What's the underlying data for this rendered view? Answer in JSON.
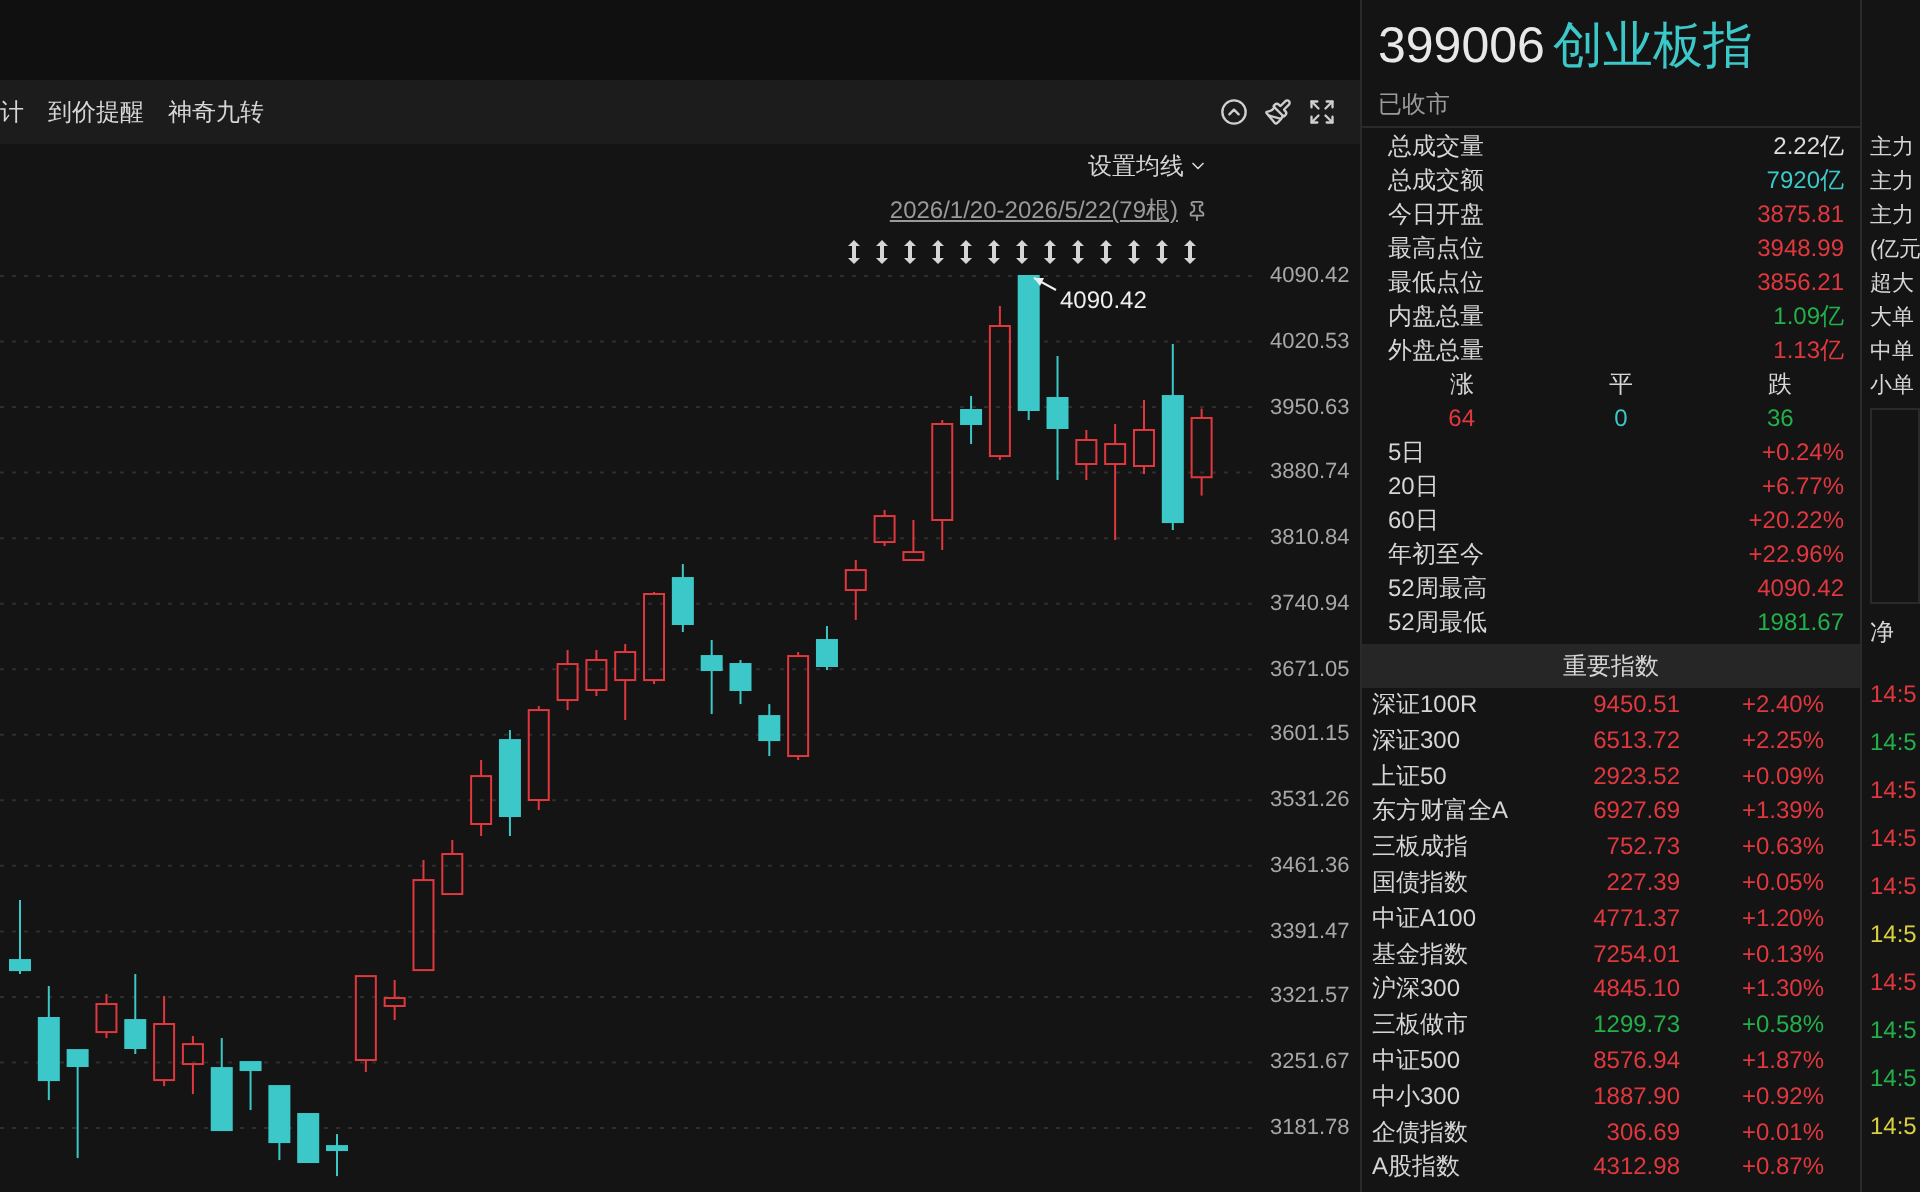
{
  "toolbar": {
    "tabs": [
      {
        "label": "计",
        "selected": false
      },
      {
        "label": "到价提醒",
        "selected": false
      },
      {
        "label": "神奇九转",
        "selected": false
      }
    ]
  },
  "chart": {
    "ma_setting": "设置均线",
    "range": "2026/1/20-2026/5/22(79根)",
    "peak_label": "4090.42",
    "chart_data": {
      "type": "candlestick",
      "grid": true,
      "ylim": [
        3181.78,
        4090.42
      ],
      "ohlc": [
        [
          3360.9,
          3424.9,
          3346.0,
          3350.2
        ],
        [
          3299.1,
          3333.2,
          3211.6,
          3232.9
        ],
        [
          3264.9,
          3264.9,
          3149.7,
          3247.9
        ],
        [
          3284.1,
          3324.7,
          3277.7,
          3314.0
        ],
        [
          3296.9,
          3346.0,
          3260.7,
          3267.1
        ],
        [
          3232.9,
          3322.5,
          3226.5,
          3292.7
        ],
        [
          3250.0,
          3279.9,
          3218.0,
          3271.3
        ],
        [
          3245.7,
          3277.7,
          3179.6,
          3179.6
        ],
        [
          3252.1,
          3252.1,
          3200.9,
          3243.6
        ],
        [
          3226.5,
          3226.5,
          3147.6,
          3166.8
        ],
        [
          3196.7,
          3196.7,
          3145.5,
          3145.5
        ],
        [
          3162.5,
          3175.3,
          3130.5,
          3158.3
        ],
        [
          3254.3,
          3343.8,
          3241.5,
          3343.8
        ],
        [
          3311.9,
          3339.6,
          3296.9,
          3320.4
        ],
        [
          3350.2,
          3467.6,
          3350.2,
          3446.2
        ],
        [
          3431.3,
          3488.9,
          3431.3,
          3474.0
        ],
        [
          3506.0,
          3574.2,
          3493.2,
          3557.1
        ],
        [
          3595.5,
          3606.2,
          3493.2,
          3514.5
        ],
        [
          3531.6,
          3631.8,
          3520.9,
          3627.5
        ],
        [
          3638.2,
          3691.5,
          3627.5,
          3676.6
        ],
        [
          3648.9,
          3691.5,
          3642.5,
          3680.9
        ],
        [
          3659.5,
          3697.9,
          3616.9,
          3689.4
        ],
        [
          3659.5,
          3753.4,
          3655.3,
          3751.3
        ],
        [
          3768.3,
          3783.2,
          3710.7,
          3719.3
        ],
        [
          3685.1,
          3702.2,
          3623.3,
          3670.2
        ],
        [
          3676.6,
          3680.9,
          3633.9,
          3648.9
        ],
        [
          3621.1,
          3633.9,
          3578.5,
          3595.5
        ],
        [
          3578.5,
          3689.4,
          3574.2,
          3685.1
        ],
        [
          3702.2,
          3717.1,
          3670.2,
          3674.5
        ],
        [
          3755.5,
          3787.5,
          3723.5,
          3776.8
        ],
        [
          3806.7,
          3840.8,
          3802.4,
          3834.4
        ],
        [
          3787.5,
          3830.2,
          3787.5,
          3796.0
        ],
        [
          3830.2,
          3936.8,
          3798.2,
          3932.6
        ],
        [
          3947.5,
          3962.4,
          3911.2,
          3932.6
        ],
        [
          3898.4,
          4058.4,
          3894.2,
          4037.1
        ],
        [
          4090.42,
          4090.42,
          3936.8,
          3947.5
        ],
        [
          3960.3,
          4005.1,
          3872.8,
          3928.3
        ],
        [
          3889.9,
          3926.2,
          3872.8,
          3915.5
        ],
        [
          3889.9,
          3932.6,
          3808.8,
          3911.2
        ],
        [
          3887.8,
          3958.2,
          3879.2,
          3926.2
        ],
        [
          3962.4,
          4017.9,
          3819.5,
          3828.0
        ],
        [
          3875.81,
          3948.99,
          3856.21,
          3939.0
        ]
      ],
      "yticks": [
        4090.42,
        4020.53,
        3950.63,
        3880.74,
        3810.84,
        3740.94,
        3671.05,
        3601.15,
        3531.26,
        3461.36,
        3391.47,
        3321.57,
        3251.67,
        3181.78
      ]
    }
  },
  "quote": {
    "code": "399006",
    "name": "创业板指",
    "status": "已收市",
    "stats": [
      {
        "label": "总成交量",
        "value": "2.22亿",
        "color": "#dddddd"
      },
      {
        "label": "总成交额",
        "value": "7920亿",
        "color": "#3cc8c8"
      },
      {
        "label": "今日开盘",
        "value": "3875.81",
        "color": "#e0383e"
      },
      {
        "label": "最高点位",
        "value": "3948.99",
        "color": "#e0383e"
      },
      {
        "label": "最低点位",
        "value": "3856.21",
        "color": "#e0383e"
      },
      {
        "label": "内盘总量",
        "value": "1.09亿",
        "color": "#22b04a"
      },
      {
        "label": "外盘总量",
        "value": "1.13亿",
        "color": "#e0383e"
      }
    ],
    "breadth": [
      {
        "label": "涨",
        "value": "64",
        "color": "#e0383e"
      },
      {
        "label": "平",
        "value": "0",
        "color": "#3cc8c8"
      },
      {
        "label": "跌",
        "value": "36",
        "color": "#22b04a"
      }
    ],
    "periods": [
      {
        "label": "5日",
        "value": "+0.24%",
        "color": "#e0383e"
      },
      {
        "label": "20日",
        "value": "+6.77%",
        "color": "#e0383e"
      },
      {
        "label": "60日",
        "value": "+20.22%",
        "color": "#e0383e"
      },
      {
        "label": "年初至今",
        "value": "+22.96%",
        "color": "#e0383e"
      },
      {
        "label": "52周最高",
        "value": "4090.42",
        "color": "#e0383e"
      },
      {
        "label": "52周最低",
        "value": "1981.67",
        "color": "#22b04a"
      }
    ]
  },
  "indices": {
    "title": "重要指数",
    "rows": [
      {
        "name": "深证100R",
        "value": "9450.51",
        "change": "+2.40%",
        "color": "#e0383e"
      },
      {
        "name": "深证300",
        "value": "6513.72",
        "change": "+2.25%",
        "color": "#e0383e"
      },
      {
        "name": "上证50",
        "value": "2923.52",
        "change": "+0.09%",
        "color": "#e0383e"
      },
      {
        "name": "东方财富全A",
        "value": "6927.69",
        "change": "+1.39%",
        "color": "#e0383e"
      },
      {
        "name": "三板成指",
        "value": "752.73",
        "change": "+0.63%",
        "color": "#e0383e"
      },
      {
        "name": "国债指数",
        "value": "227.39",
        "change": "+0.05%",
        "color": "#e0383e"
      },
      {
        "name": "中证A100",
        "value": "4771.37",
        "change": "+1.20%",
        "color": "#e0383e"
      },
      {
        "name": "基金指数",
        "value": "7254.01",
        "change": "+0.13%",
        "color": "#e0383e"
      },
      {
        "name": "沪深300",
        "value": "4845.10",
        "change": "+1.30%",
        "color": "#e0383e"
      },
      {
        "name": "三板做市",
        "value": "1299.73",
        "change": "+0.58%",
        "color": "#22b04a"
      },
      {
        "name": "中证500",
        "value": "8576.94",
        "change": "+1.87%",
        "color": "#e0383e"
      },
      {
        "name": "中小300",
        "value": "1887.90",
        "change": "+0.92%",
        "color": "#e0383e"
      },
      {
        "name": "企债指数",
        "value": "306.69",
        "change": "+0.01%",
        "color": "#e0383e"
      },
      {
        "name": "A股指数",
        "value": "4312.98",
        "change": "+0.87%",
        "color": "#e0383e"
      }
    ]
  },
  "flow": {
    "labels": [
      "主力",
      "主力",
      "主力",
      "(亿元",
      "超大",
      "大单",
      "中单",
      "小单"
    ],
    "net": "净",
    "times": [
      {
        "text": "14:5",
        "color": "#e0383e"
      },
      {
        "text": "14:5",
        "color": "#22b04a"
      },
      {
        "text": "14:5",
        "color": "#e0383e"
      },
      {
        "text": "14:5",
        "color": "#e0383e"
      },
      {
        "text": "14:5",
        "color": "#e0383e"
      },
      {
        "text": "14:5",
        "color": "#d8d040"
      },
      {
        "text": "14:5",
        "color": "#e0383e"
      },
      {
        "text": "14:5",
        "color": "#22b04a"
      },
      {
        "text": "14:5",
        "color": "#22b04a"
      },
      {
        "text": "14:5",
        "color": "#d8d040"
      }
    ]
  }
}
